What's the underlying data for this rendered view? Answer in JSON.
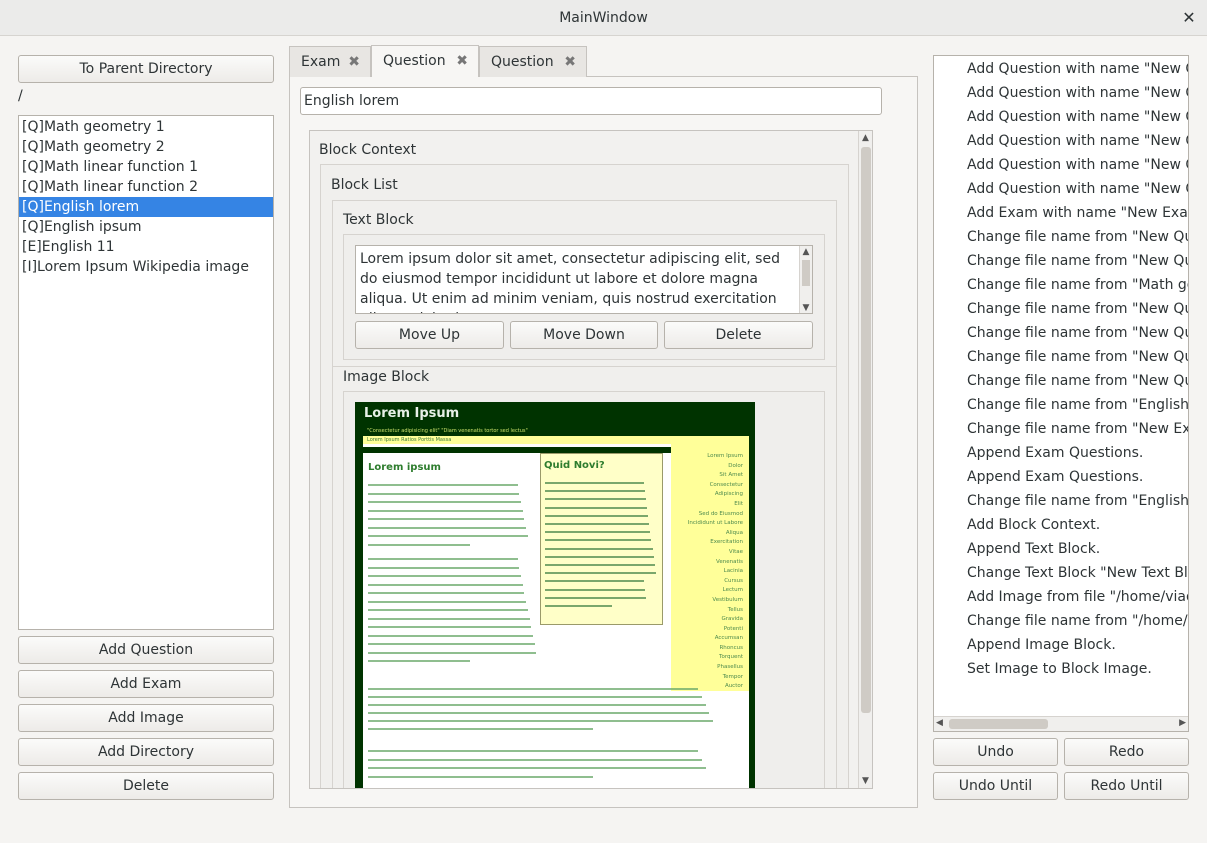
{
  "window": {
    "title": "MainWindow"
  },
  "file_browser": {
    "parent_button": "To Parent Directory",
    "current_path": "/",
    "items": [
      "[Q]Math geometry 1",
      "[Q]Math geometry 2",
      "[Q]Math linear function 1",
      "[Q]Math linear function 2",
      "[Q]English lorem",
      "[Q]English ipsum",
      "[E]English 11",
      "[I]Lorem Ipsum Wikipedia image"
    ],
    "selected_index": 4,
    "buttons": {
      "add_question": "Add Question",
      "add_exam": "Add Exam",
      "add_image": "Add Image",
      "add_directory": "Add Directory",
      "delete": "Delete"
    }
  },
  "editor": {
    "tabs": [
      {
        "label": "Exam"
      },
      {
        "label": "Question"
      },
      {
        "label": "Question"
      }
    ],
    "active_tab": 1,
    "question_name": "English lorem",
    "block_context_label": "Block Context",
    "block_list_label": "Block List",
    "text_block": {
      "label": "Text Block",
      "text": "Lorem ipsum dolor sit amet, consectetur adipiscing elit, sed do eiusmod tempor incididunt ut labore et dolore magna aliqua. Ut enim ad minim veniam, quis nostrud exercitation ullamco laboris",
      "move_up": "Move Up",
      "move_down": "Move Down",
      "delete": "Delete"
    },
    "image_block": {
      "label": "Image Block",
      "image": {
        "site_title": "Lorem Ipsum",
        "tagline": "\"Consectetur adipisicing elit\" \"Diam venenatis tortor sed lectus\"",
        "nav": "Lorem Ipsum   Ratios   Porttis   Massa",
        "heading": "Lorem ipsum",
        "sidebar_heading": "Quid Novi?",
        "right_links": [
          "Lorem Ipsum",
          "Dolor",
          "Sit Amet",
          "Consectetur",
          "Adipiscing",
          "Elit",
          "Sed do Eiusmod",
          "Incididunt ut Labore",
          "Aliqua",
          "Exercitation",
          "Vitae",
          "Venenatis",
          "Lacinia",
          "Cursus",
          "Lectum",
          "Vestibulum",
          "Tellus",
          "Gravida",
          "Potenti",
          "Accumsan",
          "Rhoncus",
          "Torquent",
          "Phasellus",
          "Tempor",
          "Auctor"
        ]
      }
    }
  },
  "history": {
    "items": [
      "Add Question with name \"New Qu",
      "Add Question with name \"New Qu",
      "Add Question with name \"New Qu",
      "Add Question with name \"New Qu",
      "Add Question with name \"New Qu",
      "Add Question with name \"New Qu",
      "Add Exam with name \"New Exam\".",
      "Change file name from \"New Ques",
      "Change file name from \"New Ques",
      "Change file name from \"Math geon",
      "Change file name from \"New Ques",
      "Change file name from \"New Ques",
      "Change file name from \"New Ques",
      "Change file name from \"New Ques",
      "Change file name from \"English lor",
      "Change file name from \"New Exam",
      "Append Exam Questions.",
      "Append Exam Questions.",
      "Change file name from \"English ips",
      "Add Block Context.",
      "Append Text Block.",
      "Change Text Block \"New Text Bloc",
      "Add Image from file \"/home/viaduc",
      "Change file name from \"/home/via",
      "Append Image Block.",
      "Set Image to Block Image."
    ],
    "buttons": {
      "undo": "Undo",
      "redo": "Redo",
      "undo_until": "Undo Until",
      "redo_until": "Redo Until"
    }
  }
}
